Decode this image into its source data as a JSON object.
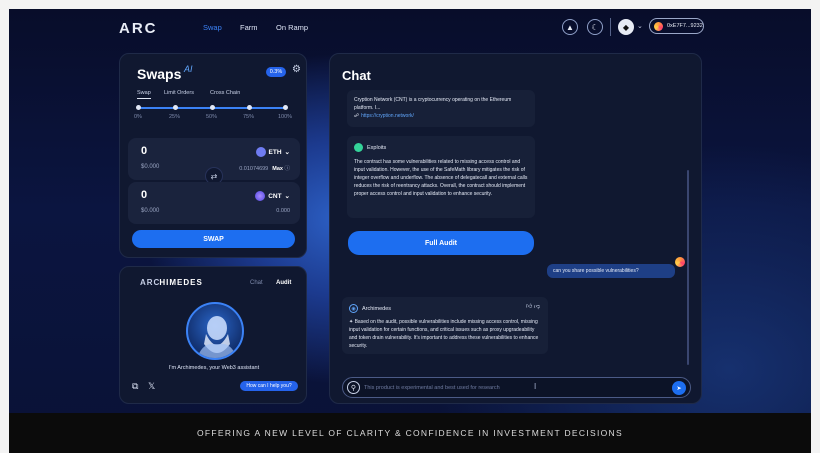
{
  "nav": {
    "logo": "ARC",
    "links": [
      "Swap",
      "Farm",
      "On Ramp"
    ],
    "active_link": "Swap",
    "wallet_address": "0xE7F7...9232",
    "accent_color": "#3b82f6"
  },
  "swap_panel": {
    "title": "Swaps",
    "title_badge": "AI",
    "slippage_badge": "0.3%",
    "tabs": [
      "Swap",
      "Limit Orders",
      "Cross Chain"
    ],
    "active_tab": "Swap",
    "slider_labels": [
      "0%",
      "25%",
      "50%",
      "75%",
      "100%"
    ],
    "slider_value_percent": 100,
    "from": {
      "amount": "0",
      "usd": "$0.000",
      "token": "ETH",
      "balance": "0.01074699",
      "max_label": "Max"
    },
    "to": {
      "amount": "0",
      "usd": "$0.000",
      "token": "CNT",
      "balance": "0.000"
    },
    "swap_button": "SWAP"
  },
  "archimedes_panel": {
    "logo_left": "ARC",
    "logo_right": "HIMEDES",
    "tabs": [
      "Chat",
      "Audit"
    ],
    "active_tab": "Audit",
    "assistant_text": "I'm Archimedes, your Web3 assistant",
    "help_button": "How can I help you?"
  },
  "chat": {
    "title": "Chat",
    "project_card": {
      "text": "Cryption Network (CNT) is a cryptocurrency operating on the Ethereum platform. I...",
      "link": "https://cryption.network/"
    },
    "exploit_card": {
      "title": "Exploits",
      "text": "The contract has some vulnerabilities related to missing access control and input validation. However, the use of the SafeMath library mitigates the risk of integer overflow and underflow. The absence of delegatecall and external calls reduces the risk of reentrancy attacks. Overall, the contract should implement proper access control and input validation to enhance security."
    },
    "full_audit_button": "Full Audit",
    "user_message": "can you share possible vulnerabilities?",
    "assistant_reply": {
      "name": "Archimedes",
      "text": "Based on the audit, possible vulnerabilities include missing access control, missing input validation for certain functions, and critical issues such as proxy upgradeability and token drain vulnerability. It's important to address these vulnerabilities to enhance security."
    },
    "input_placeholder": "This product is experimental and best used for research"
  },
  "banner": "OFFERING A NEW LEVEL OF CLARITY & CONFIDENCE IN INVESTMENT DECISIONS"
}
